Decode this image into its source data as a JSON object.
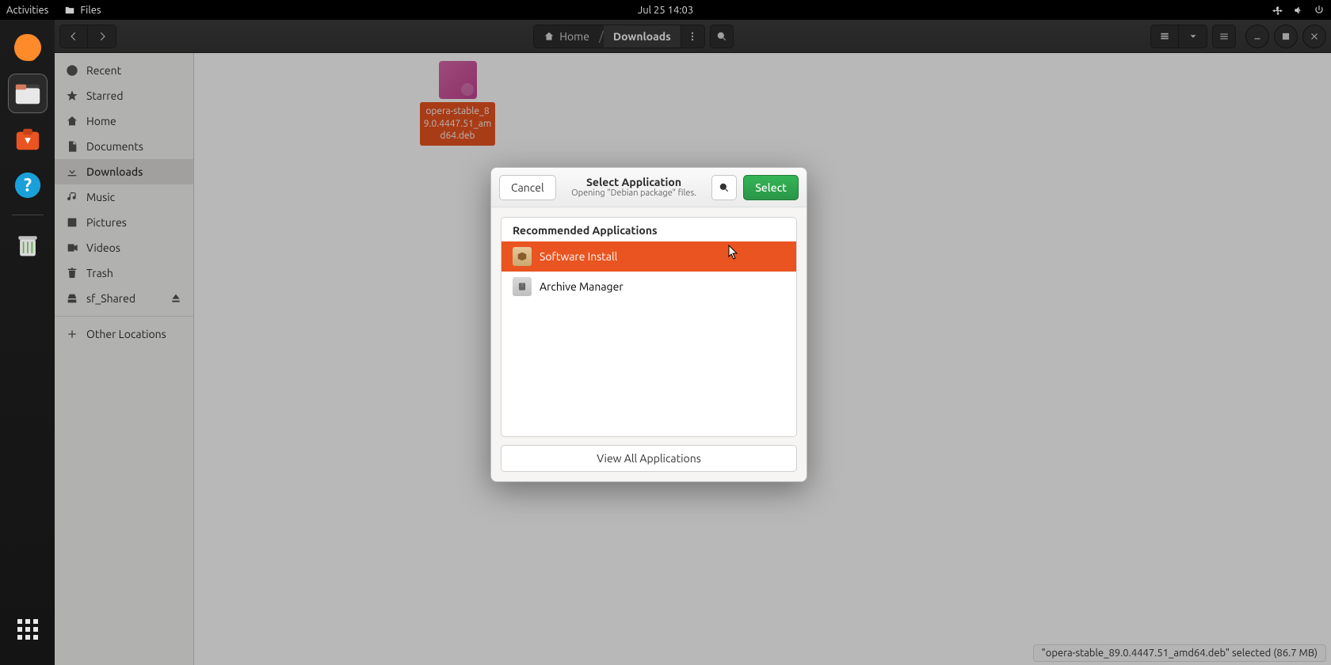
{
  "top_panel": {
    "activities": "Activities",
    "app": "Files",
    "clock": "Jul 25  14:03"
  },
  "dock": {
    "items": [
      "firefox",
      "files",
      "software",
      "help"
    ],
    "trash": "trash",
    "apps": "show-applications"
  },
  "files": {
    "path": {
      "home": "Home",
      "current": "Downloads"
    },
    "sidebar": [
      {
        "id": "recent",
        "label": "Recent"
      },
      {
        "id": "starred",
        "label": "Starred"
      },
      {
        "id": "home",
        "label": "Home"
      },
      {
        "id": "documents",
        "label": "Documents"
      },
      {
        "id": "downloads",
        "label": "Downloads",
        "active": true
      },
      {
        "id": "music",
        "label": "Music"
      },
      {
        "id": "pictures",
        "label": "Pictures"
      },
      {
        "id": "videos",
        "label": "Videos"
      },
      {
        "id": "trash",
        "label": "Trash"
      },
      {
        "id": "sf_shared",
        "label": "sf_Shared",
        "ejectable": true
      }
    ],
    "other_locations": "Other Locations",
    "file": {
      "name": "opera-stable_89.0.4447.51_amd64.deb",
      "display": "opera-stable_89.0.4447.51_amd64.deb"
    },
    "status": "\"opera-stable_89.0.4447.51_amd64.deb\" selected  (86.7 MB)"
  },
  "dialog": {
    "cancel": "Cancel",
    "select": "Select",
    "title": "Select Application",
    "subtitle": "Opening \"Debian package\" files.",
    "section": "Recommended Applications",
    "apps": [
      {
        "id": "software-install",
        "label": "Software Install",
        "selected": true
      },
      {
        "id": "archive-manager",
        "label": "Archive Manager"
      }
    ],
    "view_all": "View All Applications"
  }
}
